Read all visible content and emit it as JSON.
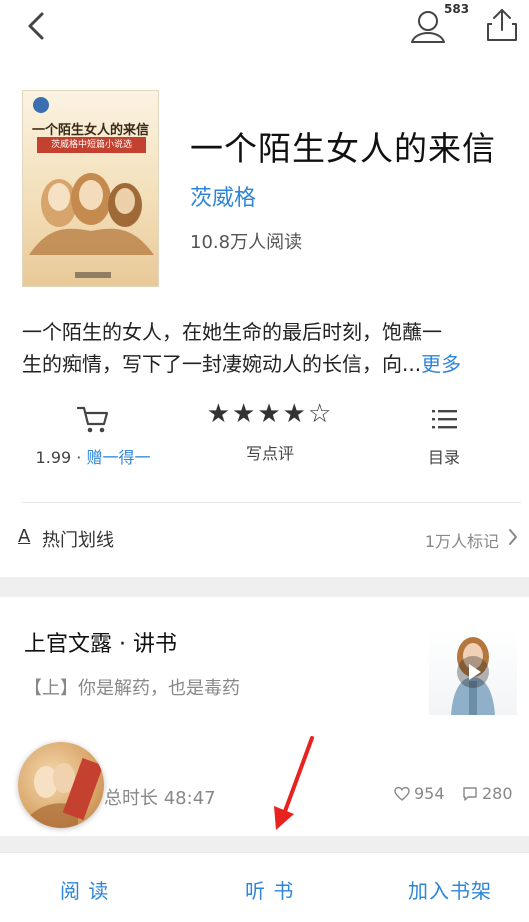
{
  "topbar": {
    "follow_count": "583"
  },
  "book": {
    "title": "一个陌生女人的来信",
    "author": "茨威格",
    "readers": "10.8万人阅读",
    "cover_title": "一个陌生女人的来信",
    "cover_subtitle": "茨威格中短篇小说选",
    "description_line1": "一个陌生的女人，在她生命的最后时刻，饱蘸一",
    "description_line2": "生的痴情，写下了一封凄婉动人的长信，向...",
    "more_label": "更多"
  },
  "actions": {
    "price": "1.99",
    "price_sep": " · ",
    "gift_label": "赠一得一",
    "rating_stars": "★★★★☆",
    "review_label": "写点评",
    "toc_label": "目录"
  },
  "highlights": {
    "icon_glyph": "A",
    "label": "热门划线",
    "count": "1万人标记"
  },
  "audio": {
    "title": "上官文露 · 讲书",
    "subtitle": "【上】你是解药，也是毒药",
    "duration": "总时长 48:47",
    "likes": "954",
    "comments": "280"
  },
  "bottombar": {
    "read_label": "阅 读",
    "listen_label": "听 书",
    "shelf_label": "加入书架"
  },
  "colors": {
    "accent": "#2f86d8",
    "arrow": "#e8231f"
  }
}
